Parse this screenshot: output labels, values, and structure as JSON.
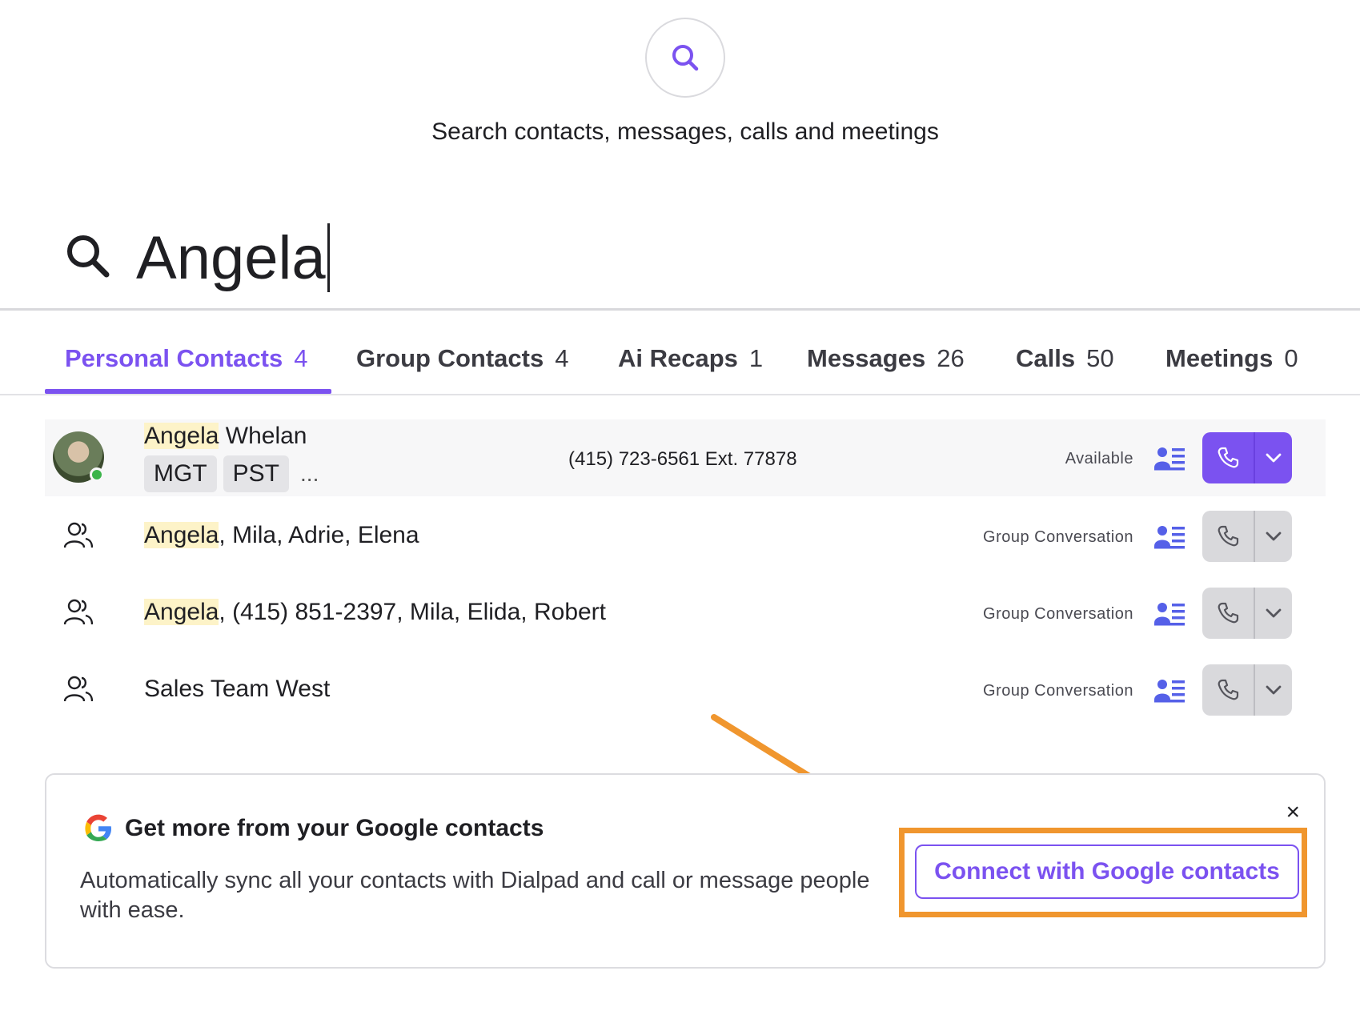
{
  "hero": {
    "icon": "search-icon",
    "subtitle": "Search contacts, messages, calls and meetings"
  },
  "search": {
    "value": "Angela",
    "icon": "search-icon"
  },
  "tabs": [
    {
      "label": "Personal Contacts",
      "count": "4",
      "active": true
    },
    {
      "label": "Group Contacts",
      "count": "4",
      "active": false
    },
    {
      "label": "Ai Recaps",
      "count": "1",
      "active": false
    },
    {
      "label": "Messages",
      "count": "26",
      "active": false
    },
    {
      "label": "Calls",
      "count": "50",
      "active": false
    },
    {
      "label": "Meetings",
      "count": "0",
      "active": false
    }
  ],
  "results": [
    {
      "type": "person",
      "name_highlight": "Angela",
      "name_rest": " Whelan",
      "tags": [
        "MGT",
        "PST"
      ],
      "tags_more": "...",
      "phone": "(415) 723-6561 Ext. 77878",
      "status": "Available",
      "call_style": "purple"
    },
    {
      "type": "group",
      "name_highlight": "Angela",
      "name_rest": ", Mila, Adrie, Elena",
      "status": "Group Conversation",
      "call_style": "grey"
    },
    {
      "type": "group",
      "name_highlight": "Angela",
      "name_rest": ", (415) 851-2397, Mila, Elida, Robert",
      "status": "Group Conversation",
      "call_style": "grey"
    },
    {
      "type": "group",
      "name_highlight": "",
      "name_rest": "Sales Team West",
      "status": "Group Conversation",
      "call_style": "grey"
    }
  ],
  "promo": {
    "title": "Get more from your Google contacts",
    "body": "Automatically sync all your contacts with Dialpad and call or message people with ease.",
    "button": "Connect with Google contacts",
    "close": "×"
  },
  "colors": {
    "accent": "#7b52f0",
    "annotation": "#f0962e",
    "highlight": "#fdf3c8",
    "presence": "#3bb44a"
  }
}
